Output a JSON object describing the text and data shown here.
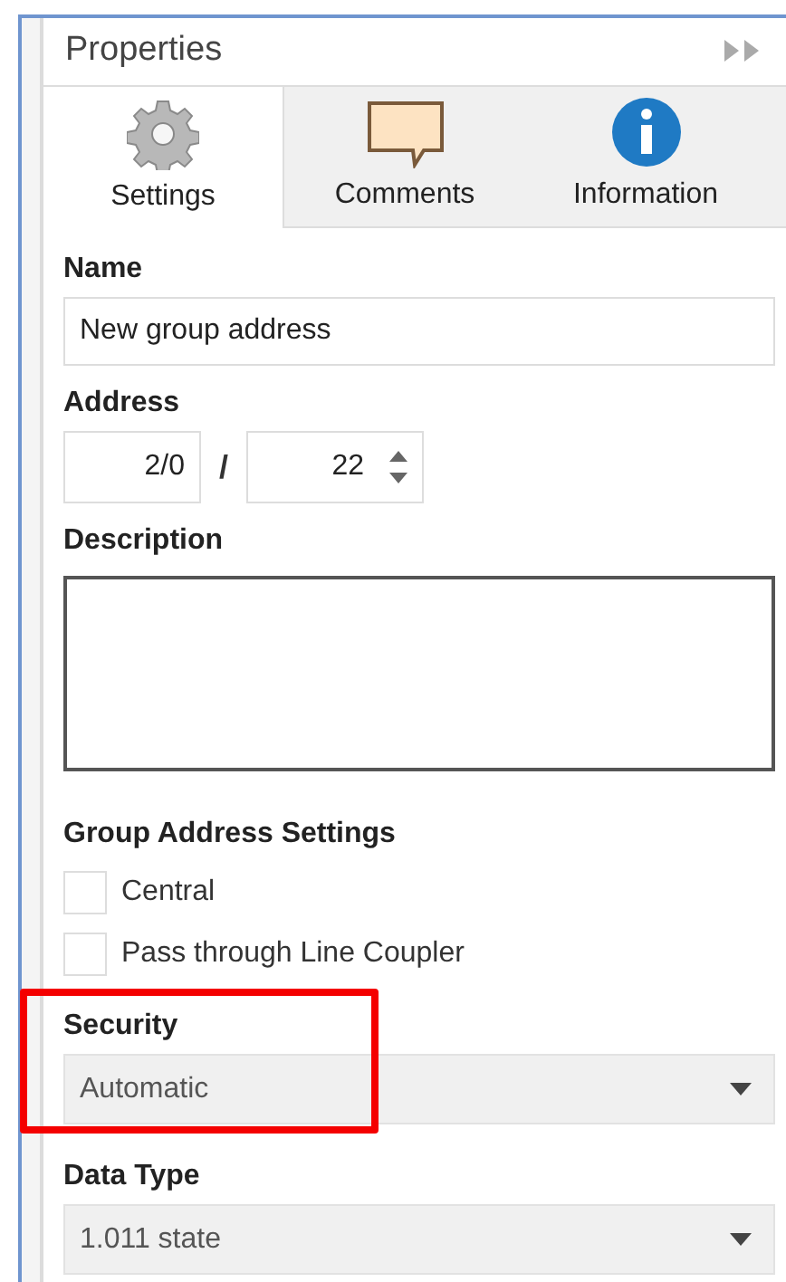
{
  "panel": {
    "title": "Properties"
  },
  "tabs": [
    {
      "label": "Settings",
      "kind": "gear",
      "selected": true
    },
    {
      "label": "Comments",
      "kind": "comment",
      "selected": false
    },
    {
      "label": "Information",
      "kind": "info",
      "selected": false
    }
  ],
  "name": {
    "label": "Name",
    "value": "New group address"
  },
  "address": {
    "label": "Address",
    "main": "2/0",
    "separator": "/",
    "sub": "22"
  },
  "description": {
    "label": "Description"
  },
  "group_settings": {
    "label": "Group Address Settings",
    "options": [
      {
        "label": "Central",
        "checked": false
      },
      {
        "label": "Pass through Line Coupler",
        "checked": false
      }
    ]
  },
  "dropdowns": [
    {
      "label": "Security",
      "value": "Automatic",
      "highlighted": true
    },
    {
      "label": "Data Type",
      "value": "1.011 state",
      "highlighted": false
    }
  ]
}
